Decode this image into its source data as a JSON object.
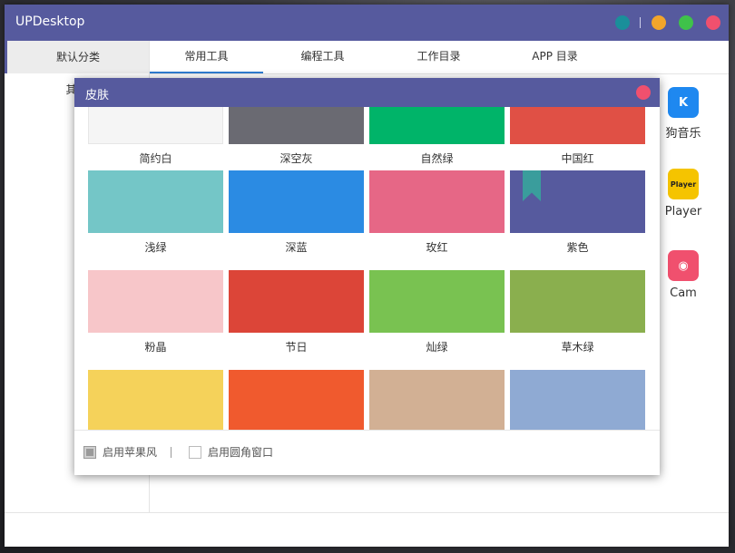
{
  "window": {
    "title": "UPDesktop",
    "buttons": [
      {
        "name": "skin-button",
        "color": "#1a8f9a"
      },
      {
        "name": "minimize-button",
        "color": "#f2a52b"
      },
      {
        "name": "maximize-button",
        "color": "#3fc24a"
      },
      {
        "name": "close-button",
        "color": "#f0506e"
      }
    ]
  },
  "leftnav": {
    "items": [
      {
        "label": "默认分类",
        "active": true
      },
      {
        "label": "其他"
      }
    ]
  },
  "tabs": [
    {
      "label": "常用工具",
      "active": true
    },
    {
      "label": "编程工具"
    },
    {
      "label": "工作目录"
    },
    {
      "label": "APP 目录"
    }
  ],
  "background_apps": [
    {
      "label": "酷狗音乐",
      "visible_text": "狗音乐",
      "icon": "K",
      "color": "#1e88f0"
    },
    {
      "label": "PotPlayer",
      "visible_text": "Player",
      "icon": "Player",
      "color": "#f5c400"
    },
    {
      "label": "Cam",
      "visible_text": "Cam",
      "icon": "camera",
      "color": "#f0506e"
    }
  ],
  "dialog": {
    "title": "皮肤",
    "skins": [
      {
        "label": "简约白",
        "color": "#f5f5f5"
      },
      {
        "label": "深空灰",
        "color": "#6a6a72"
      },
      {
        "label": "自然绿",
        "color": "#00b469"
      },
      {
        "label": "中国红",
        "color": "#e05045"
      },
      {
        "label": "浅绿",
        "color": "#74c6c7"
      },
      {
        "label": "深蓝",
        "color": "#2b8be3"
      },
      {
        "label": "玫红",
        "color": "#e66786"
      },
      {
        "label": "紫色",
        "color": "#565a9e",
        "selected": true
      },
      {
        "label": "粉晶",
        "color": "#f7c6c9"
      },
      {
        "label": "节日",
        "color": "#dc4538"
      },
      {
        "label": "灿绿",
        "color": "#79c251"
      },
      {
        "label": "草木绿",
        "color": "#8aaf4e"
      },
      {
        "label": "",
        "color": "#f5d25a"
      },
      {
        "label": "",
        "color": "#f05a2e"
      },
      {
        "label": "",
        "color": "#d2b094"
      },
      {
        "label": "",
        "color": "#8faad3"
      }
    ],
    "options": [
      {
        "label": "启用苹果风",
        "checked": true
      },
      {
        "label": "启用圆角窗口",
        "checked": false
      }
    ]
  },
  "colors": {
    "accent": "#565a9e",
    "tab_underline": "#2f7dd1"
  }
}
